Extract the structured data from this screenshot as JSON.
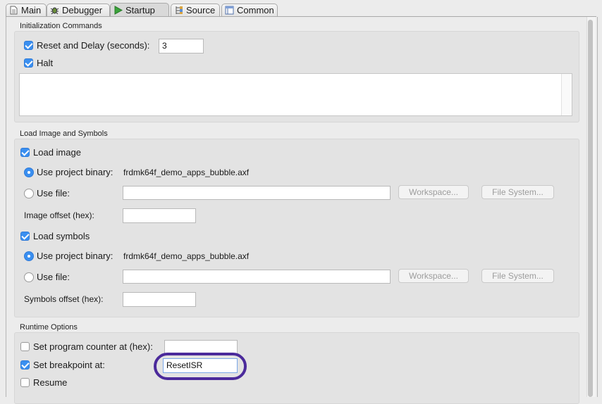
{
  "tabs": [
    {
      "label": "Main",
      "icon": "document-icon"
    },
    {
      "label": "Debugger",
      "icon": "bug-icon"
    },
    {
      "label": "Startup",
      "icon": "play-icon",
      "active": true
    },
    {
      "label": "Source",
      "icon": "source-lookup-icon"
    },
    {
      "label": "Common",
      "icon": "window-icon"
    }
  ],
  "init": {
    "title": "Initialization Commands",
    "reset_label": "Reset and Delay (seconds):",
    "reset_checked": true,
    "reset_value": "3",
    "halt_label": "Halt",
    "halt_checked": true,
    "commands_text": ""
  },
  "load": {
    "title": "Load Image and Symbols",
    "load_image_label": "Load image",
    "use_project_binary_label": "Use project binary:",
    "project_binary": "frdmk64f_demo_apps_bubble.axf",
    "use_file_label": "Use file:",
    "workspace_label": "Workspace...",
    "file_system_label": "File System...",
    "image_offset_label": "Image offset (hex):",
    "load_symbols_label": "Load symbols",
    "symbols_offset_label": "Symbols offset (hex):"
  },
  "runtime": {
    "title": "Runtime Options",
    "set_pc_label": "Set program counter at (hex):",
    "set_pc_checked": false,
    "set_pc_value": "",
    "set_bp_label": "Set breakpoint at:",
    "set_bp_checked": true,
    "set_bp_value": "ResetISR",
    "resume_label": "Resume",
    "resume_checked": false
  },
  "colors": {
    "accent": "#3a8ff0",
    "highlight_ring": "#4b2a9b"
  }
}
